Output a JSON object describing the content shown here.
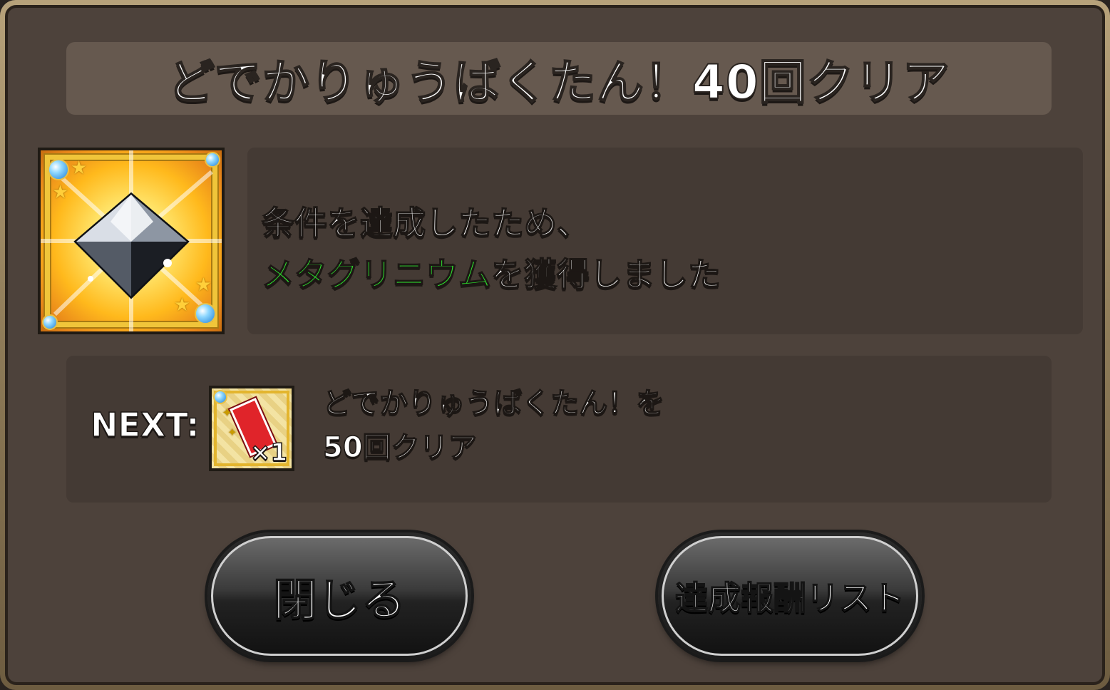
{
  "dialog": {
    "title": "どでかりゅうばくたん！40回クリア"
  },
  "reward": {
    "icon": "metagrinium-crystal-icon",
    "message_line1": "条件を達成したため、",
    "item_name": "メタグリニウム",
    "message_line2_suffix": "を獲得しました",
    "item_name_color": "#2ee82e"
  },
  "next": {
    "label": "NEXT:",
    "icon": "ticket-icon",
    "count": "×1",
    "desc_line1": "どでかりゅうばくたん！を",
    "desc_line2": "50回クリア"
  },
  "buttons": {
    "close_label": "閉じる",
    "list_label": "達成報酬リスト"
  }
}
